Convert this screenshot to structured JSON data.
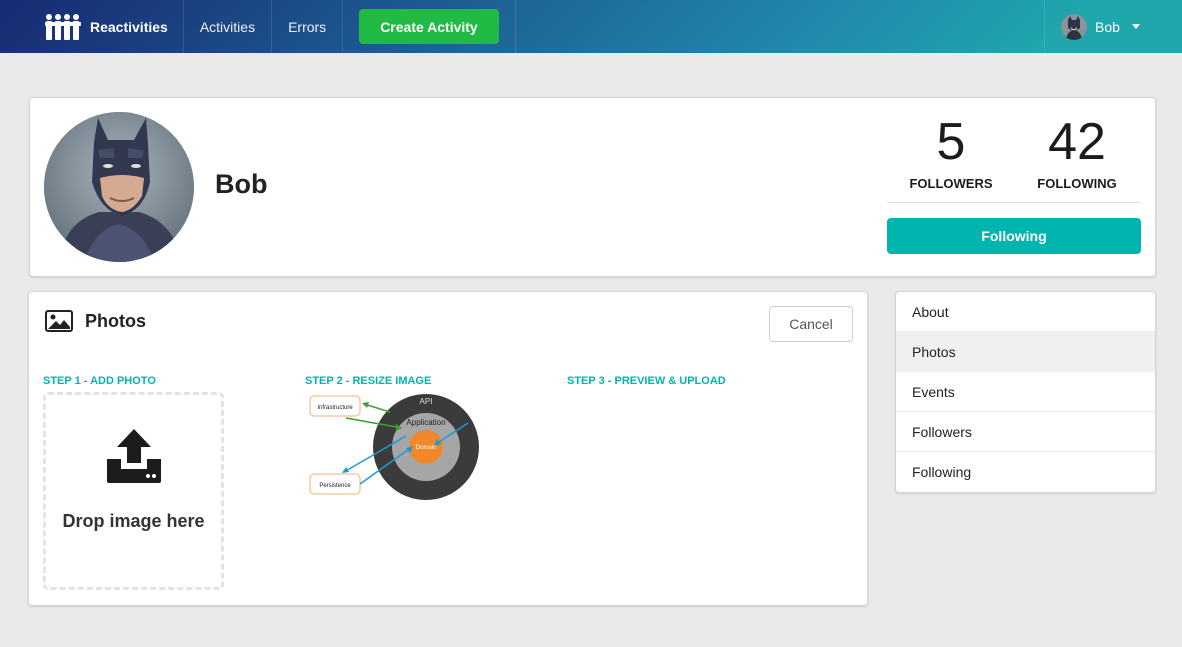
{
  "navbar": {
    "brand": "Reactivities",
    "activities": "Activities",
    "errors": "Errors",
    "create_activity": "Create Activity",
    "user_name": "Bob"
  },
  "profile": {
    "name": "Bob",
    "followers_count": "5",
    "followers_label": "FOLLOWERS",
    "following_count": "42",
    "following_label": "FOLLOWING",
    "follow_button": "Following"
  },
  "photos": {
    "title": "Photos",
    "cancel": "Cancel",
    "step1": "STEP 1 - ADD PHOTO",
    "step2": "STEP 2 - RESIZE IMAGE",
    "step3": "STEP 3 - PREVIEW & UPLOAD",
    "drop_text": "Drop image here",
    "diagram_labels": {
      "api": "API",
      "application": "Application",
      "domain": "Domain",
      "infrastructure": "Infrastructure",
      "persistence": "Persistence"
    }
  },
  "side_menu": {
    "items": [
      {
        "label": "About"
      },
      {
        "label": "Photos"
      },
      {
        "label": "Events"
      },
      {
        "label": "Followers"
      },
      {
        "label": "Following"
      }
    ],
    "active_index": 1
  },
  "colors": {
    "accent_teal": "#00b5ad",
    "create_green": "#21ba45",
    "navbar_gradient_start": "#182a73",
    "navbar_gradient_end": "#20a7ac"
  }
}
